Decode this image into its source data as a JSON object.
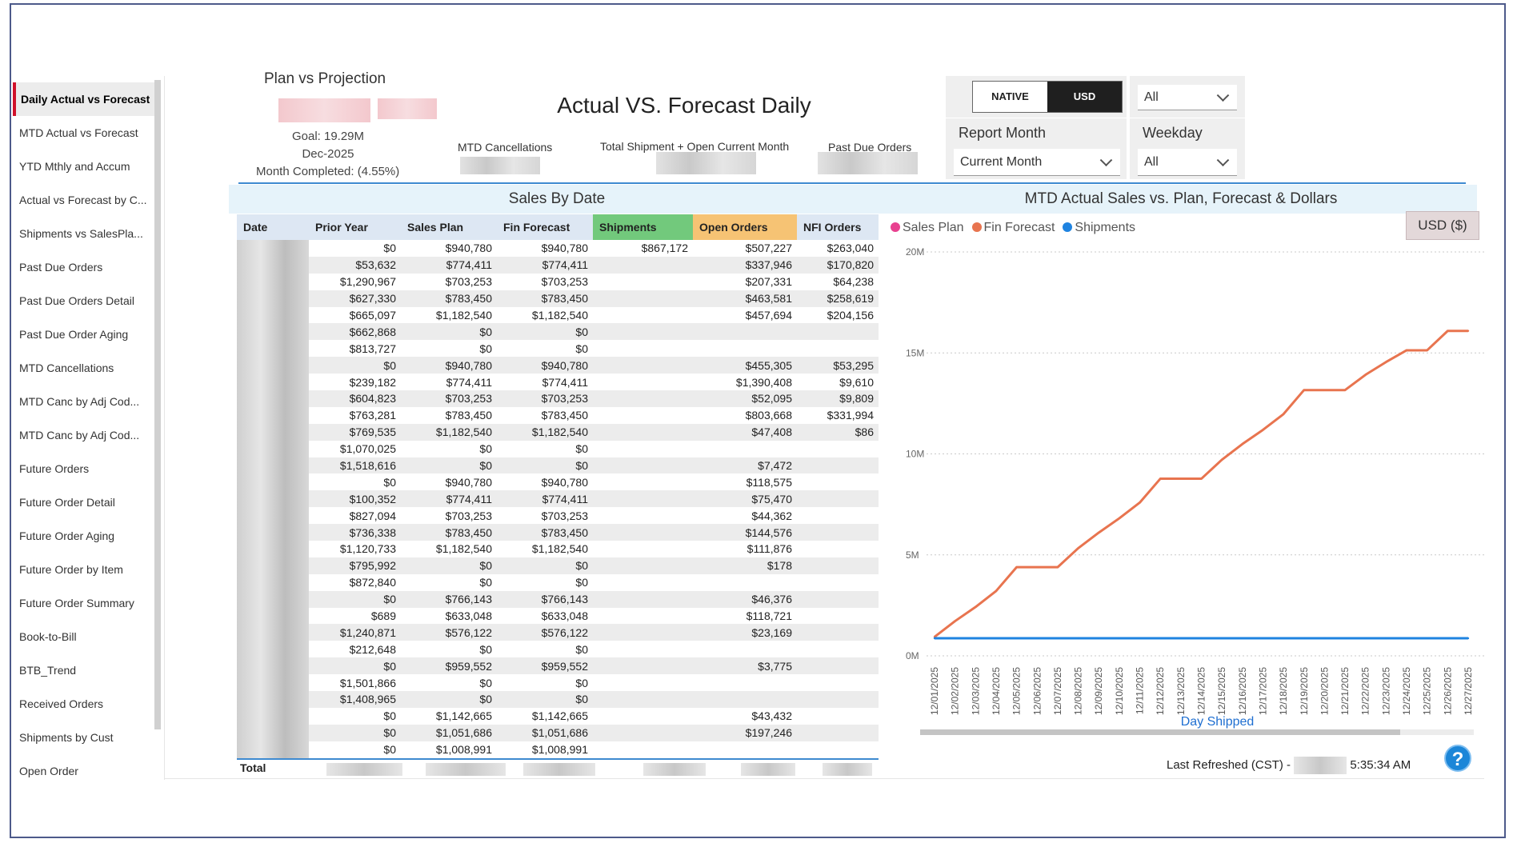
{
  "sidebar": {
    "items": [
      {
        "label": "Daily Actual vs Forecast",
        "active": true
      },
      {
        "label": "MTD Actual vs Forecast"
      },
      {
        "label": "YTD Mthly and Accum"
      },
      {
        "label": "Actual vs Forecast by C..."
      },
      {
        "label": "Shipments vs SalesPla..."
      },
      {
        "label": "Past Due Orders"
      },
      {
        "label": "Past Due Orders Detail"
      },
      {
        "label": "Past Due Order Aging"
      },
      {
        "label": "MTD Cancellations"
      },
      {
        "label": "MTD Canc by Adj Cod..."
      },
      {
        "label": "MTD Canc by Adj Cod..."
      },
      {
        "label": "Future Orders"
      },
      {
        "label": "Future Order Detail"
      },
      {
        "label": "Future Order Aging"
      },
      {
        "label": "Future Order by Item"
      },
      {
        "label": "Future Order Summary"
      },
      {
        "label": "Book-to-Bill"
      },
      {
        "label": "BTB_Trend"
      },
      {
        "label": "Received Orders"
      },
      {
        "label": "Shipments by Cust"
      },
      {
        "label": "Open Order"
      }
    ]
  },
  "header": {
    "plan_title": "Plan vs Projection",
    "goal": "Goal: 19.29M",
    "month": "Dec-2025",
    "month_completed": "Month Completed: (4.55%)",
    "main_title": "Actual VS. Forecast Daily",
    "kpi_cancellations": "MTD Cancellations",
    "kpi_shipment_open": "Total Shipment + Open Current Month",
    "kpi_past_due": "Past Due Orders"
  },
  "slicers": {
    "native_label": "NATIVE",
    "usd_label": "USD",
    "top_right_value": "All",
    "report_month_title": "Report Month",
    "report_month_value": "Current Month",
    "weekday_title": "Weekday",
    "weekday_value": "All"
  },
  "table": {
    "title": "Sales By Date",
    "columns": [
      "Date",
      "Prior Year",
      "Sales Plan",
      "Fin Forecast",
      "Shipments",
      "Open Orders",
      "NFI Orders"
    ],
    "header_colors": {
      "Date": "#dde7f3",
      "Shipments": "#72c97c",
      "Open Orders": "#f6c374",
      "default": "#dde7f3"
    },
    "rows": [
      [
        "$0",
        "$940,780",
        "$940,780",
        "$867,172",
        "$507,227",
        "$263,040"
      ],
      [
        "$53,632",
        "$774,411",
        "$774,411",
        "",
        "$337,946",
        "$170,820"
      ],
      [
        "$1,290,967",
        "$703,253",
        "$703,253",
        "",
        "$207,331",
        "$64,238"
      ],
      [
        "$627,330",
        "$783,450",
        "$783,450",
        "",
        "$463,581",
        "$258,619"
      ],
      [
        "$665,097",
        "$1,182,540",
        "$1,182,540",
        "",
        "$457,694",
        "$204,156"
      ],
      [
        "$662,868",
        "$0",
        "$0",
        "",
        "",
        ""
      ],
      [
        "$813,727",
        "$0",
        "$0",
        "",
        "",
        ""
      ],
      [
        "$0",
        "$940,780",
        "$940,780",
        "",
        "$455,305",
        "$53,295"
      ],
      [
        "$239,182",
        "$774,411",
        "$774,411",
        "",
        "$1,390,408",
        "$9,610"
      ],
      [
        "$604,823",
        "$703,253",
        "$703,253",
        "",
        "$52,095",
        "$9,809"
      ],
      [
        "$763,281",
        "$783,450",
        "$783,450",
        "",
        "$803,668",
        "$331,994"
      ],
      [
        "$769,535",
        "$1,182,540",
        "$1,182,540",
        "",
        "$47,408",
        "$86"
      ],
      [
        "$1,070,025",
        "$0",
        "$0",
        "",
        "",
        ""
      ],
      [
        "$1,518,616",
        "$0",
        "$0",
        "",
        "$7,472",
        ""
      ],
      [
        "$0",
        "$940,780",
        "$940,780",
        "",
        "$118,575",
        ""
      ],
      [
        "$100,352",
        "$774,411",
        "$774,411",
        "",
        "$75,470",
        ""
      ],
      [
        "$827,094",
        "$703,253",
        "$703,253",
        "",
        "$44,362",
        ""
      ],
      [
        "$736,338",
        "$783,450",
        "$783,450",
        "",
        "$144,576",
        ""
      ],
      [
        "$1,120,733",
        "$1,182,540",
        "$1,182,540",
        "",
        "$111,876",
        ""
      ],
      [
        "$795,992",
        "$0",
        "$0",
        "",
        "$178",
        ""
      ],
      [
        "$872,840",
        "$0",
        "$0",
        "",
        "",
        ""
      ],
      [
        "$0",
        "$766,143",
        "$766,143",
        "",
        "$46,376",
        ""
      ],
      [
        "$689",
        "$633,048",
        "$633,048",
        "",
        "$118,721",
        ""
      ],
      [
        "$1,240,871",
        "$576,122",
        "$576,122",
        "",
        "$23,169",
        ""
      ],
      [
        "$212,648",
        "$0",
        "$0",
        "",
        "",
        ""
      ],
      [
        "$0",
        "$959,552",
        "$959,552",
        "",
        "$3,775",
        ""
      ],
      [
        "$1,501,866",
        "$0",
        "$0",
        "",
        "",
        ""
      ],
      [
        "$1,408,965",
        "$0",
        "$0",
        "",
        "",
        ""
      ],
      [
        "$0",
        "$1,142,665",
        "$1,142,665",
        "",
        "$43,432",
        ""
      ],
      [
        "$0",
        "$1,051,686",
        "$1,051,686",
        "",
        "$197,246",
        ""
      ],
      [
        "$0",
        "$1,008,991",
        "$1,008,991",
        "",
        "",
        ""
      ]
    ],
    "total_label": "Total"
  },
  "chart_section": {
    "title": "MTD Actual Sales vs. Plan, Forecast & Dollars",
    "currency_button": "USD ($)",
    "last_refreshed_label": "Last Refreshed (CST) -",
    "last_refreshed_time": "5:35:34 AM"
  },
  "chart_data": {
    "type": "line",
    "title": "",
    "xlabel": "Day Shipped",
    "ylabel": "",
    "ylim": [
      0,
      20
    ],
    "yticks": [
      "0M",
      "5M",
      "10M",
      "15M",
      "20M"
    ],
    "grid": true,
    "legend_position": "top-left",
    "x": [
      "12/01/2025",
      "12/02/2025",
      "12/03/2025",
      "12/04/2025",
      "12/05/2025",
      "12/06/2025",
      "12/07/2025",
      "12/08/2025",
      "12/09/2025",
      "12/10/2025",
      "12/11/2025",
      "12/12/2025",
      "12/13/2025",
      "12/14/2025",
      "12/15/2025",
      "12/16/2025",
      "12/17/2025",
      "12/18/2025",
      "12/19/2025",
      "12/20/2025",
      "12/21/2025",
      "12/22/2025",
      "12/23/2025",
      "12/24/2025",
      "12/25/2025",
      "12/26/2025",
      "12/27/2025"
    ],
    "series": [
      {
        "name": "Sales Plan",
        "color": "#e8418f",
        "values": []
      },
      {
        "name": "Fin Forecast",
        "color": "#e8744f",
        "values": [
          0.94,
          1.72,
          2.42,
          3.21,
          4.39,
          4.39,
          4.39,
          5.33,
          6.1,
          6.81,
          7.59,
          8.77,
          8.77,
          8.77,
          9.71,
          10.49,
          11.19,
          11.97,
          13.16,
          13.16,
          13.16,
          13.92,
          14.55,
          15.13,
          15.13,
          16.09,
          16.09
        ]
      },
      {
        "name": "Shipments",
        "color": "#1f83e0",
        "values": [
          0.87,
          0.87,
          0.87,
          0.87,
          0.87,
          0.87,
          0.87,
          0.87,
          0.87,
          0.87,
          0.87,
          0.87,
          0.87,
          0.87,
          0.87,
          0.87,
          0.87,
          0.87,
          0.87,
          0.87,
          0.87,
          0.87,
          0.87,
          0.87,
          0.87,
          0.87,
          0.87
        ]
      }
    ]
  }
}
